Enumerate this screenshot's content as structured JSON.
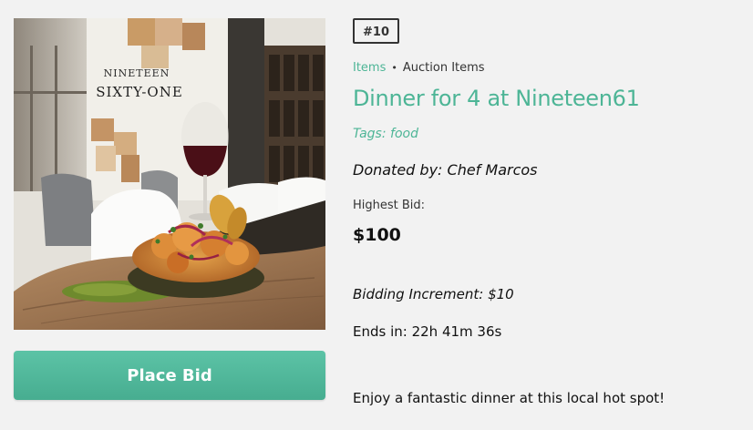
{
  "item": {
    "lot_number": "#10",
    "breadcrumb": {
      "link": "Items",
      "separator": "•",
      "current": "Auction Items"
    },
    "title": "Dinner for 4 at Nineteen61",
    "tags": "Tags: food",
    "donated_by": "Donated by: Chef Marcos",
    "highest_bid_label": "Highest Bid:",
    "highest_bid_value": "$100",
    "bidding_increment": "Bidding Increment: $10",
    "ends_in": "Ends in: 22h 41m 36s",
    "description": "Enjoy a fantastic dinner at this local hot spot!"
  },
  "photo": {
    "sign_line1": "NINETEEN",
    "sign_line2": "SIXTY-ONE"
  },
  "actions": {
    "place_bid_label": "Place Bid"
  },
  "colors": {
    "accent": "#4db596",
    "button": "#52b89b",
    "background": "#f2f2f2"
  }
}
